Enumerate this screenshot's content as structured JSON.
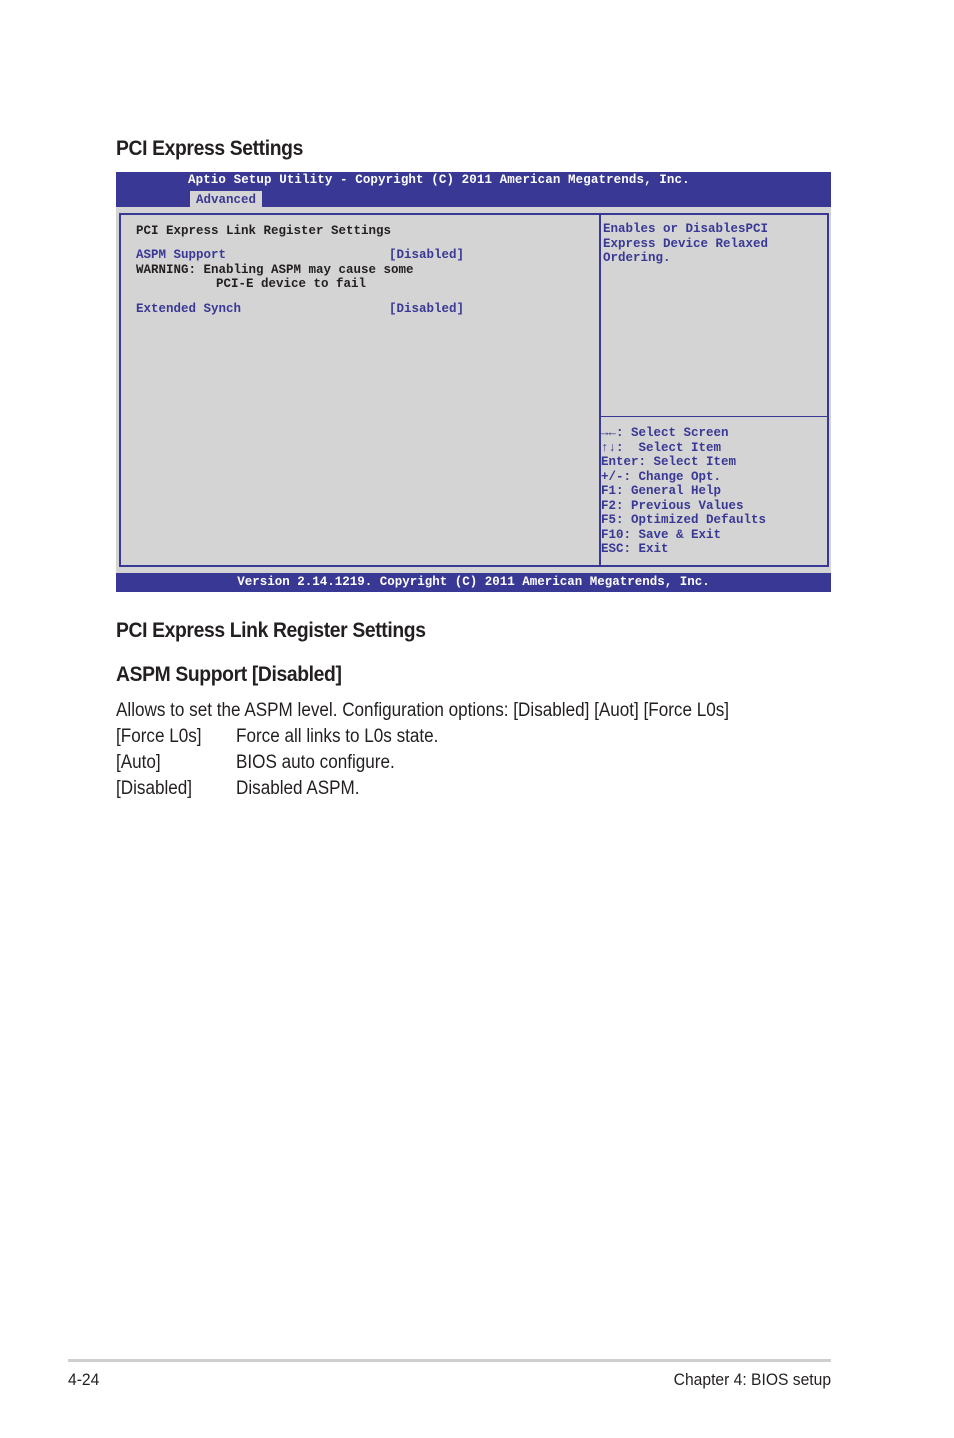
{
  "headings": {
    "section": "PCI Express Settings",
    "subsection": "PCI Express Link Register Settings",
    "item": "ASPM Support [Disabled]"
  },
  "bios": {
    "title": "Aptio Setup Utility - Copyright (C) 2011 American Megatrends, Inc.",
    "active_tab": "Advanced",
    "main": {
      "group_title": "PCI Express Link Register Settings",
      "items": [
        {
          "label": "ASPM Support",
          "value": "[Disabled]"
        },
        {
          "label": "Extended Synch",
          "value": "[Disabled]"
        }
      ],
      "warning_line1": "WARNING: Enabling ASPM may cause some",
      "warning_line2": "PCI-E device to fail"
    },
    "help_text": [
      "Enables or DisablesPCI",
      "Express Device Relaxed",
      "Ordering."
    ],
    "keys": [
      "→←: Select Screen",
      "↑↓:  Select Item",
      "Enter: Select Item",
      "+/-: Change Opt.",
      "F1: General Help",
      "F2: Previous Values",
      "F5: Optimized Defaults",
      "F10: Save & Exit",
      "ESC: Exit"
    ],
    "version": "Version 2.14.1219. Copyright (C) 2011 American Megatrends, Inc.",
    "colors": {
      "bar": "#393894",
      "panel": "#d4d4d4",
      "text_blue": "#393894"
    }
  },
  "description": {
    "intro": "Allows to set the ASPM level. Configuration options: [Disabled] [Auot] [Force L0s]",
    "options": [
      {
        "key": "[Force L0s]",
        "desc": "Force all links to L0s state."
      },
      {
        "key": "[Auto]",
        "desc": "BIOS auto configure."
      },
      {
        "key": "[Disabled]",
        "desc": "Disabled ASPM."
      }
    ]
  },
  "footer": {
    "page_number": "4-24",
    "chapter": "Chapter 4: BIOS setup"
  }
}
